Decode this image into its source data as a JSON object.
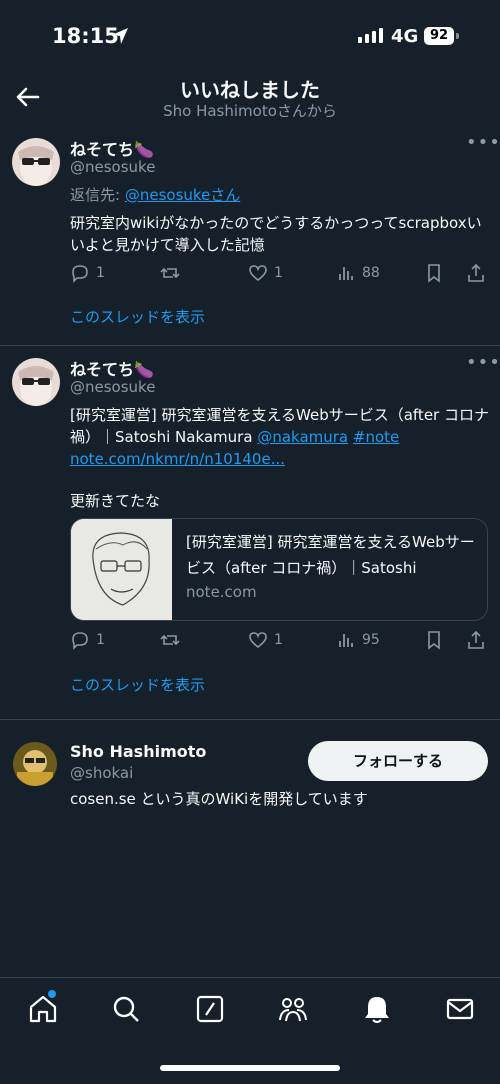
{
  "status": {
    "time": "18:15",
    "network": "4G",
    "battery": "92"
  },
  "header": {
    "title": "いいねしました",
    "subtitle": "Sho Hashimotoさんから"
  },
  "posts": [
    {
      "name": "ねそてち🍆",
      "handle": "@nesosuke",
      "reply_label": "返信先:",
      "reply_to": "@nesosukeさん",
      "body": "研究室内wikiがなかったのでどうするかっつってscrapboxいいよと見かけて導入した記憶",
      "replies": "1",
      "likes": "1",
      "views": "88",
      "thread_link": "このスレッドを表示"
    },
    {
      "name": "ねそてち🍆",
      "handle": "@nesosuke",
      "body_prefix": "[研究室運営] 研究室運営を支えるWebサービス（after コロナ禍）｜Satoshi Nakamura",
      "mention": "@nakamura",
      "hashtag": "#note",
      "url": "note.com/nkmr/n/n10140e...",
      "body2": "更新きてたな",
      "card_title": "[研究室運営] 研究室運営を支えるWebサービス（after コロナ禍）｜Satoshi Nakamura",
      "card_domain": "note.com",
      "replies": "1",
      "likes": "1",
      "views": "95",
      "thread_link": "このスレッドを表示"
    }
  ],
  "user": {
    "name": "Sho Hashimoto",
    "handle": "@shokai",
    "bio": "cosen.se という真のWiKiを開発しています",
    "follow_label": "フォローする"
  },
  "tabs": [
    "home-icon",
    "search-icon",
    "compose-icon",
    "communities-icon",
    "notifications-icon",
    "messages-icon"
  ],
  "colors": {
    "background": "#15202b",
    "accent": "#1d9bf0",
    "muted": "#8b98a5"
  }
}
